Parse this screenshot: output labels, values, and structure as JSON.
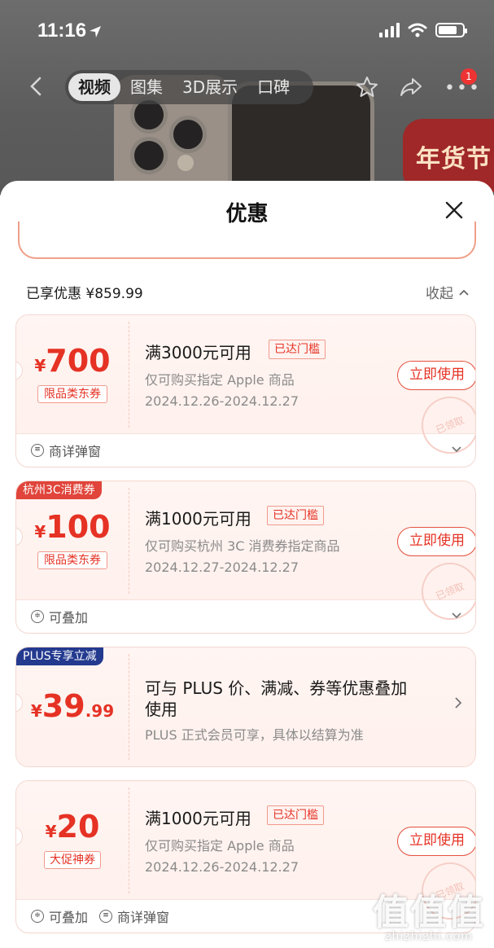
{
  "status_bar": {
    "time": "11:16"
  },
  "nav": {
    "tabs": [
      "视频",
      "图集",
      "3D展示",
      "口碑"
    ],
    "notification_count": "1"
  },
  "banner": {
    "promo_text": "年货节"
  },
  "sheet": {
    "title": "优惠",
    "summary_label": "已享优惠 ¥859.99",
    "collapse_label": "收起"
  },
  "coupons": [
    {
      "currency": "¥",
      "amount": "700",
      "decimal": "",
      "tag": "限品类东券",
      "condition": "满3000元可用",
      "threshold_badge": "已达门槛",
      "description": "仅可购买指定 Apple 商品",
      "date_range": "2024.12.26-2024.12.27",
      "button": "立即使用",
      "stamp": "已领取",
      "foot": [
        "商详弹窗"
      ]
    },
    {
      "corner_tag": "杭州3C消费券",
      "currency": "¥",
      "amount": "100",
      "decimal": "",
      "tag": "限品类东券",
      "condition": "满1000元可用",
      "threshold_badge": "已达门槛",
      "description": "仅可购买杭州 3C 消费券指定商品",
      "date_range": "2024.12.27-2024.12.27",
      "button": "立即使用",
      "stamp": "已领取",
      "foot": [
        "可叠加"
      ]
    },
    {
      "corner_tag": "PLUS专享立减",
      "currency": "¥",
      "amount": "39",
      "decimal": ".99",
      "condition_line1": "可与 PLUS 价、满减、券等优惠叠加",
      "condition_line2": "使用",
      "description": "PLUS 正式会员可享，具体以结算为准"
    },
    {
      "currency": "¥",
      "amount": "20",
      "decimal": "",
      "tag": "大促神券",
      "condition": "满1000元可用",
      "threshold_badge": "已达门槛",
      "description": "仅可购买指定 Apple 商品",
      "date_range": "2024.12.26-2024.12.27",
      "button": "立即使用",
      "stamp": "已领取",
      "foot": [
        "可叠加",
        "商详弹窗"
      ]
    }
  ],
  "watermark": {
    "big": "值值值",
    "small": "zhizhizhi.com"
  },
  "colors": {
    "accent": "#e53224",
    "plus_tag": "#233a8f",
    "hz_tag": "#e0443a"
  }
}
